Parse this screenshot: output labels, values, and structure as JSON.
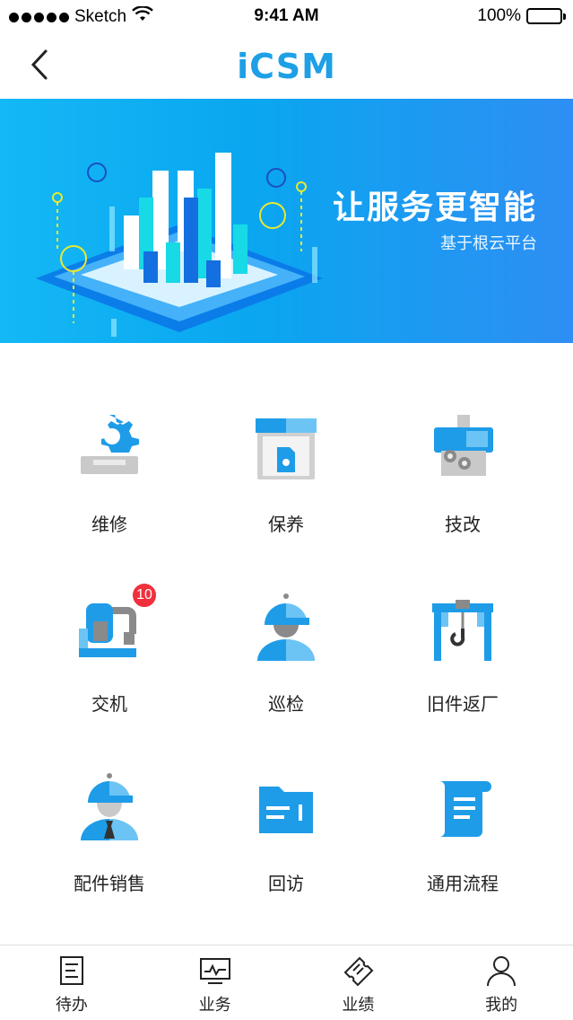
{
  "status_bar": {
    "carrier": "Sketch",
    "time": "9:41 AM",
    "battery": "100%"
  },
  "nav": {
    "logo_text": "iCSM",
    "back_icon": "chevron-left-icon"
  },
  "banner": {
    "title": "让服务更智能",
    "subtitle": "基于根云平台"
  },
  "colors": {
    "accent": "#1ea0e6",
    "banner_start": "#14b8f5",
    "banner_end": "#2e8ef3",
    "badge": "#f0303d"
  },
  "grid": {
    "items": [
      {
        "label": "维修",
        "icon": "gear-repair-icon"
      },
      {
        "label": "保养",
        "icon": "oil-shop-icon"
      },
      {
        "label": "技改",
        "icon": "machine-upgrade-icon"
      },
      {
        "label": "交机",
        "icon": "machine-delivery-icon",
        "badge": "10"
      },
      {
        "label": "巡检",
        "icon": "inspector-icon"
      },
      {
        "label": "旧件返厂",
        "icon": "gantry-crane-icon"
      },
      {
        "label": "配件销售",
        "icon": "salesperson-icon"
      },
      {
        "label": "回访",
        "icon": "folder-icon"
      },
      {
        "label": "通用流程",
        "icon": "document-scroll-icon"
      }
    ]
  },
  "tab_bar": {
    "tabs": [
      {
        "label": "待办",
        "icon": "todo-list-icon"
      },
      {
        "label": "业务",
        "icon": "monitor-chart-icon"
      },
      {
        "label": "业绩",
        "icon": "ticket-icon"
      },
      {
        "label": "我的",
        "icon": "user-icon"
      }
    ]
  }
}
